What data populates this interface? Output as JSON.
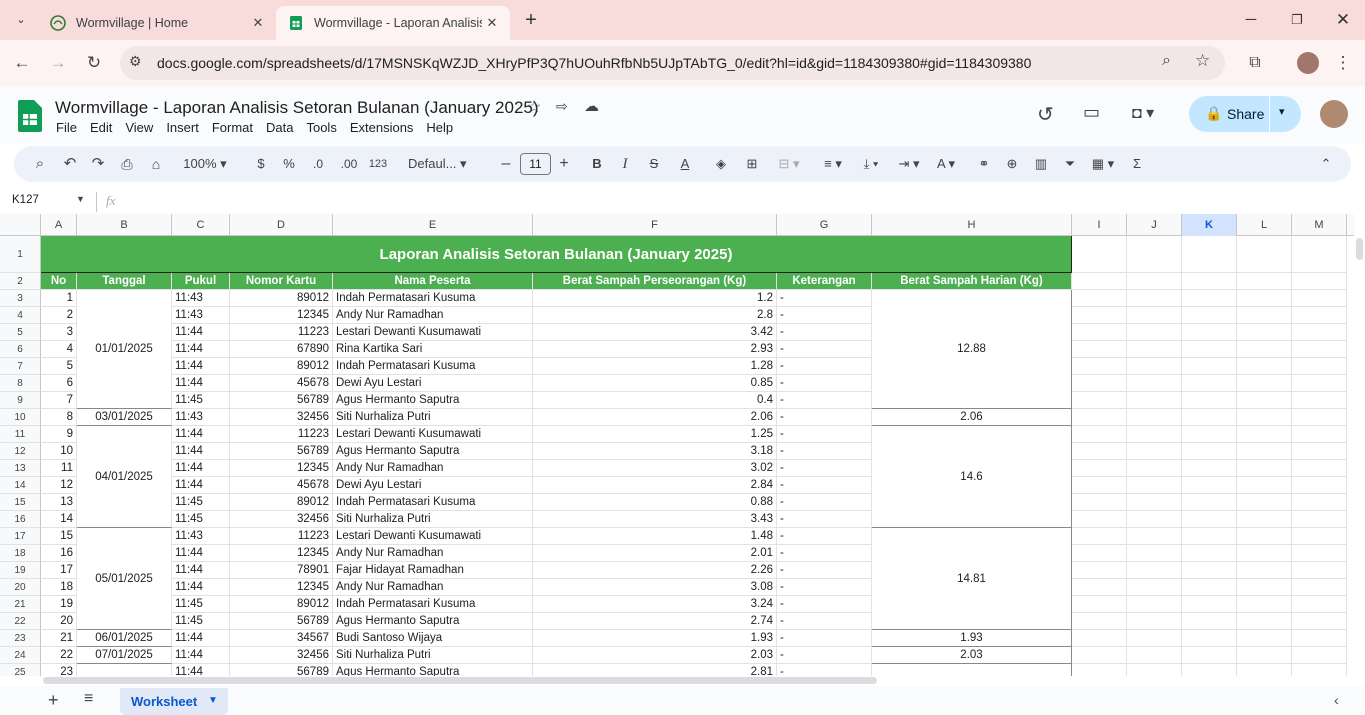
{
  "browser": {
    "tabs": [
      {
        "title": "Wormvillage | Home",
        "active": false
      },
      {
        "title": "Wormvillage - Laporan Analisis",
        "active": true
      }
    ],
    "url": "docs.google.com/spreadsheets/d/17MSNSKqWZJD_XHryPfP3Q7hUOuhRfbNb5UJpTAbTG_0/edit?hl=id&gid=1184309380#gid=1184309380"
  },
  "doc": {
    "title": "Wormvillage - Laporan Analisis Setoran Bulanan (January 2025)",
    "menus": [
      "File",
      "Edit",
      "View",
      "Insert",
      "Format",
      "Data",
      "Tools",
      "Extensions",
      "Help"
    ],
    "share_label": "Share"
  },
  "toolbar": {
    "zoom": "100%",
    "currency": "$",
    "percent": "%",
    "dec_decrease": ".0",
    "dec_increase": ".00",
    "number_format": "123",
    "font": "Defaul...",
    "font_size": "11"
  },
  "formula_bar": {
    "name_box": "K127",
    "fx": "fx",
    "formula": ""
  },
  "columns": [
    "A",
    "B",
    "C",
    "D",
    "E",
    "F",
    "G",
    "H",
    "I",
    "J",
    "K",
    "L",
    "M"
  ],
  "row_numbers": [
    "1",
    "2",
    "3",
    "4",
    "5",
    "6",
    "7",
    "8",
    "9",
    "10",
    "11",
    "12",
    "13",
    "14",
    "15",
    "16",
    "17",
    "18",
    "19",
    "20",
    "21",
    "22",
    "23",
    "24",
    "25"
  ],
  "sheet": {
    "title": "Laporan Analisis Setoran Bulanan (January 2025)",
    "headers": [
      "No",
      "Tanggal",
      "Pukul",
      "Nomor Kartu",
      "Nama Peserta",
      "Berat Sampah Perseorangan (Kg)",
      "Keterangan",
      "Berat Sampah Harian (Kg)"
    ],
    "rows": [
      [
        "1",
        "11:43",
        "89012",
        "Indah Permatasari Kusuma",
        "1.2",
        "-"
      ],
      [
        "2",
        "11:43",
        "12345",
        "Andy Nur Ramadhan",
        "2.8",
        "-"
      ],
      [
        "3",
        "11:44",
        "11223",
        "Lestari Dewanti Kusumawati",
        "3.42",
        "-"
      ],
      [
        "4",
        "11:44",
        "67890",
        "Rina Kartika Sari",
        "2.93",
        "-"
      ],
      [
        "5",
        "11:44",
        "89012",
        "Indah Permatasari Kusuma",
        "1.28",
        "-"
      ],
      [
        "6",
        "11:44",
        "45678",
        "Dewi Ayu Lestari",
        "0.85",
        "-"
      ],
      [
        "7",
        "11:45",
        "56789",
        "Agus Hermanto Saputra",
        "0.4",
        "-"
      ],
      [
        "8",
        "11:43",
        "32456",
        "Siti Nurhaliza Putri",
        "2.06",
        "-"
      ],
      [
        "9",
        "11:44",
        "11223",
        "Lestari Dewanti Kusumawati",
        "1.25",
        "-"
      ],
      [
        "10",
        "11:44",
        "56789",
        "Agus Hermanto Saputra",
        "3.18",
        "-"
      ],
      [
        "11",
        "11:44",
        "12345",
        "Andy Nur Ramadhan",
        "3.02",
        "-"
      ],
      [
        "12",
        "11:44",
        "45678",
        "Dewi Ayu Lestari",
        "2.84",
        "-"
      ],
      [
        "13",
        "11:45",
        "89012",
        "Indah Permatasari Kusuma",
        "0.88",
        "-"
      ],
      [
        "14",
        "11:45",
        "32456",
        "Siti Nurhaliza Putri",
        "3.43",
        "-"
      ],
      [
        "15",
        "11:43",
        "11223",
        "Lestari Dewanti Kusumawati",
        "1.48",
        "-"
      ],
      [
        "16",
        "11:44",
        "12345",
        "Andy Nur Ramadhan",
        "2.01",
        "-"
      ],
      [
        "17",
        "11:44",
        "78901",
        "Fajar Hidayat Ramadhan",
        "2.26",
        "-"
      ],
      [
        "18",
        "11:44",
        "12345",
        "Andy Nur Ramadhan",
        "3.08",
        "-"
      ],
      [
        "19",
        "11:45",
        "89012",
        "Indah Permatasari Kusuma",
        "3.24",
        "-"
      ],
      [
        "20",
        "11:45",
        "56789",
        "Agus Hermanto Saputra",
        "2.74",
        "-"
      ],
      [
        "21",
        "11:44",
        "34567",
        "Budi Santoso Wijaya",
        "1.93",
        "-"
      ],
      [
        "22",
        "11:44",
        "32456",
        "Siti Nurhaliza Putri",
        "2.03",
        "-"
      ],
      [
        "23",
        "11:44",
        "56789",
        "Agus Hermanto Saputra",
        "2.81",
        "-"
      ]
    ],
    "date_groups": [
      {
        "date": "01/01/2025",
        "daily": "12.88",
        "start": 0,
        "count": 7
      },
      {
        "date": "03/01/2025",
        "daily": "2.06",
        "start": 7,
        "count": 1
      },
      {
        "date": "04/01/2025",
        "daily": "14.6",
        "start": 8,
        "count": 6
      },
      {
        "date": "05/01/2025",
        "daily": "14.81",
        "start": 14,
        "count": 6
      },
      {
        "date": "06/01/2025",
        "daily": "1.93",
        "start": 20,
        "count": 1
      },
      {
        "date": "07/01/2025",
        "daily": "2.03",
        "start": 21,
        "count": 1
      },
      {
        "date": "",
        "daily": "",
        "start": 22,
        "count": 1
      }
    ]
  },
  "bottom": {
    "sheet_tab": "Worksheet"
  },
  "colors": {
    "header_green": "#4caf50",
    "share_bg": "#c2e7ff",
    "accent": "#0b57d0"
  }
}
